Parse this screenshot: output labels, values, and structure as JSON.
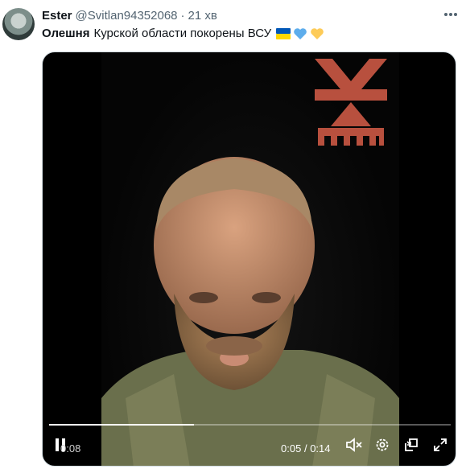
{
  "author": {
    "name": "Ester",
    "handle": "@Svitlan94352068",
    "separator": "·",
    "time": "21 хв"
  },
  "tweet": {
    "bold_word": "Олешня",
    "text": "Курской области покорены ВСУ",
    "emojis": [
      "flag-ukraine-icon",
      "blue-heart-icon",
      "yellow-heart-icon"
    ]
  },
  "video": {
    "current_time": "0:05",
    "separator": "/",
    "duration": "0:14",
    "paused_label": "0:08",
    "progress": 0.36,
    "controls": [
      "pause-icon",
      "mute-icon",
      "settings-icon",
      "pip-icon",
      "fullscreen-icon"
    ]
  },
  "colors": {
    "logo": "#b8503e",
    "text_primary": "#0f1419",
    "text_secondary": "#536471",
    "flag_blue": "#0057b7",
    "flag_yellow": "#ffd700"
  }
}
